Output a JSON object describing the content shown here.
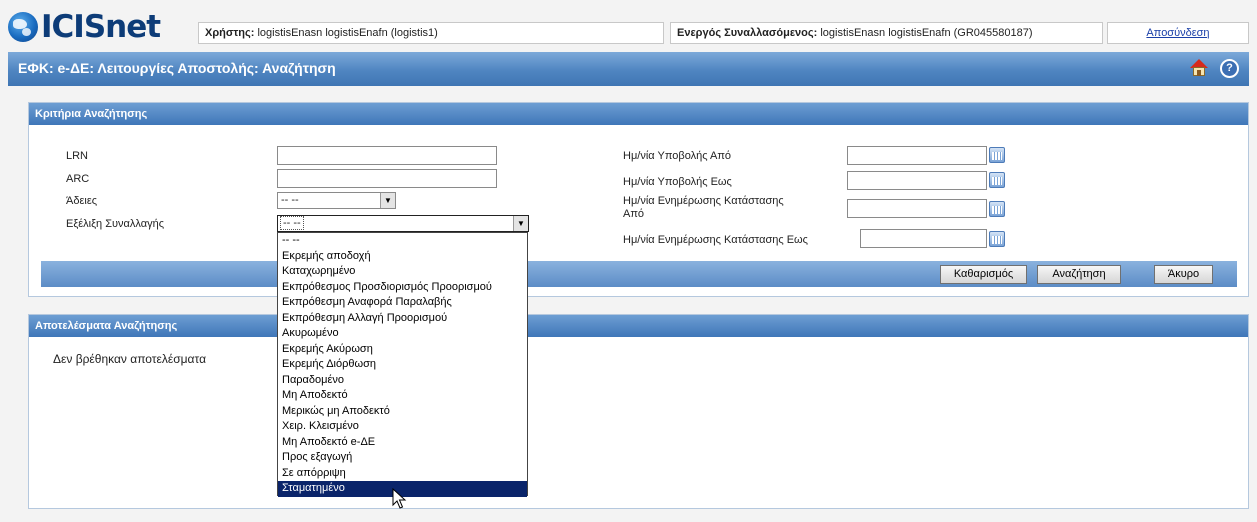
{
  "header": {
    "logo_text": "ICISnet",
    "user_label": "Χρήστης:",
    "user_value": "logistisEnasn logistisEnafn (logistis1)",
    "trader_label": "Ενεργός Συναλλασόμενος:",
    "trader_value": "logistisEnasn logistisEnafn (GR045580187)",
    "logout_label": "Αποσύνδεση"
  },
  "title_bar": {
    "title": "ΕΦΚ: e-ΔΕ: Λειτουργίες Αποστολής: Αναζήτηση",
    "home_icon": "home-icon",
    "help_icon": "help-icon",
    "help_glyph": "?"
  },
  "criteria": {
    "heading": "Κριτήρια Αναζήτησης",
    "lrn_label": "LRN",
    "lrn_value": "",
    "arc_label": "ARC",
    "arc_value": "",
    "permits_label": "Άδειες",
    "permits_value": "-- --",
    "progress_label": "Εξέλιξη Συναλλαγής",
    "progress_value": "-- --",
    "submit_from_label": "Ημ/νία Υποβολής Από",
    "submit_from_value": "",
    "submit_to_label": "Ημ/νία Υποβολής Εως",
    "submit_to_value": "",
    "status_from_label_1": "Ημ/νία Ενημέρωσης Κατάστασης",
    "status_from_label_2": "Από",
    "status_from_value": "",
    "status_to_label": "Ημ/νία Ενημέρωσης Κατάστασης Εως",
    "status_to_value": ""
  },
  "buttons": {
    "clear": "Καθαρισμός",
    "search": "Αναζήτηση",
    "cancel": "Άκυρο"
  },
  "results": {
    "heading": "Αποτελέσματα Αναζήτησης",
    "empty_text": "Δεν βρέθηκαν αποτελέσματα"
  },
  "dropdown": {
    "options": [
      "-- --",
      "Εκρεμής αποδοχή",
      "Καταχωρημένο",
      "Εκπρόθεσμος Προσδιορισμός Προορισμού",
      "Εκπρόθεσμη Αναφορά Παραλαβής",
      "Εκπρόθεσμη Αλλαγή Προορισμού",
      "Ακυρωμένο",
      "Εκρεμής Ακύρωση",
      "Εκρεμής Διόρθωση",
      "Παραδομένο",
      "Μη Αποδεκτό",
      "Μερικώς μη Αποδεκτό",
      "Χειρ. Κλεισμένο",
      "Μη Αποδεκτό e-ΔΕ",
      "Προς εξαγωγή",
      "Σε απόρριψη",
      "Σταματημένο"
    ],
    "highlighted_index": 16
  }
}
